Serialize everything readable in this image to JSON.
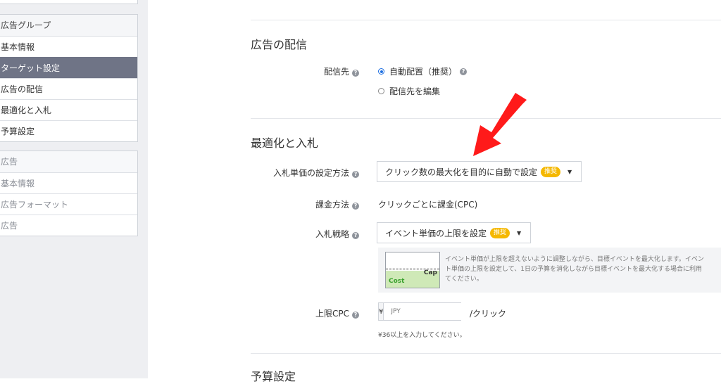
{
  "sidebar": {
    "group1": {
      "header": "広告グループ",
      "items": [
        "基本情報",
        "ターゲット設定",
        "広告の配信",
        "最適化と入札",
        "予算設定"
      ]
    },
    "group2": {
      "header": "広告",
      "items": [
        "基本情報",
        "広告フォーマット",
        "広告"
      ]
    }
  },
  "delivery": {
    "title": "広告の配信",
    "label": "配信先",
    "options": [
      "自動配置（推奨）",
      "配信先を編集"
    ]
  },
  "bidding": {
    "title": "最適化と入札",
    "method_label": "入札単価の設定方法",
    "method_value": "クリック数の最大化を目的に自動で設定",
    "recommended_badge": "推奨",
    "billing_label": "課金方法",
    "billing_value": "クリックごとに課金(CPC)",
    "strategy_label": "入札戦略",
    "strategy_value": "イベント単価の上限を設定",
    "info_lines": [
      "イベント単価が上限を超えないように調整しながら、目標イベントを最大化します。イベン",
      "ト単価の上限を設定して、1日の予算を消化しながら目標イベントを最大化する場合に利用",
      "てください。"
    ],
    "diagram_cost": "Cost",
    "diagram_cap": "Cap",
    "cap_cpc_label": "上限CPC",
    "currency_symbol": "¥",
    "cpc_placeholder": "JPY",
    "cpc_suffix": "/クリック",
    "cpc_hint": "¥36以上を入力してください。"
  },
  "budget": {
    "title": "予算設定"
  },
  "icons": {
    "help": "?",
    "caret": "▼"
  },
  "colors": {
    "sidebar_active": "#6f7486",
    "badge": "#f5b800",
    "radio_selected": "#1f6fe0",
    "annotation_arrow": "#ff1a1a"
  }
}
